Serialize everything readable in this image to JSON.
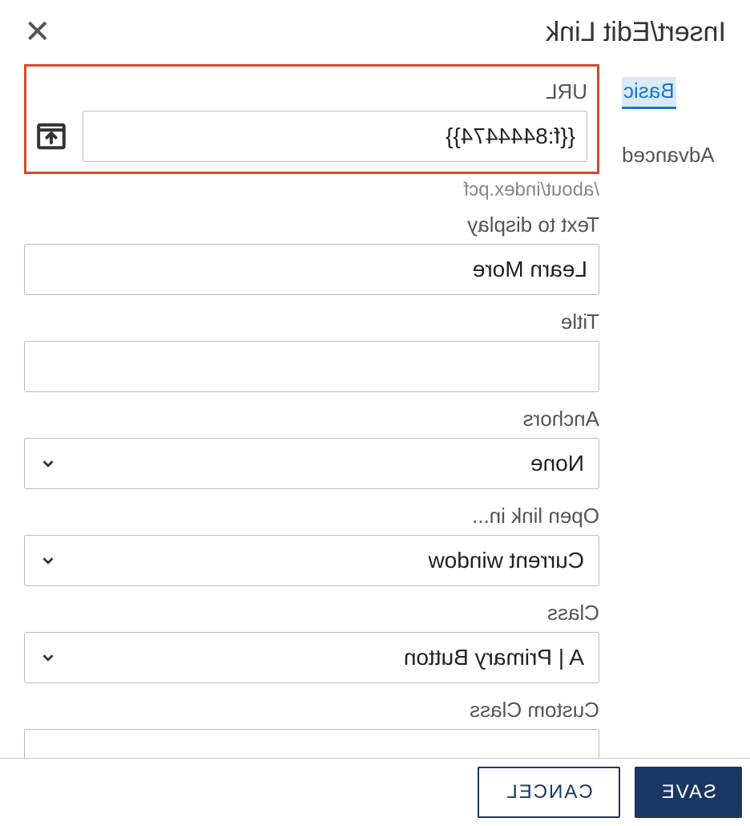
{
  "header": {
    "title": "Insert/Edit Link"
  },
  "tabs": {
    "basic": "Basic",
    "advanced": "Advanced"
  },
  "fields": {
    "url": {
      "label": "URL",
      "value": "{{f:8444474}}",
      "helper": "/about/index.pcf"
    },
    "text_display": {
      "label": "Text to display",
      "value": "Learn More"
    },
    "title": {
      "label": "Title",
      "value": ""
    },
    "anchors": {
      "label": "Anchors",
      "value": "None"
    },
    "open_in": {
      "label": "Open link in...",
      "value": "Current window"
    },
    "class": {
      "label": "Class",
      "value": "A | Primary Button"
    },
    "custom_class": {
      "label": "Custom Class",
      "value": ""
    }
  },
  "buttons": {
    "save": "SAVE",
    "cancel": "CANCEL"
  }
}
